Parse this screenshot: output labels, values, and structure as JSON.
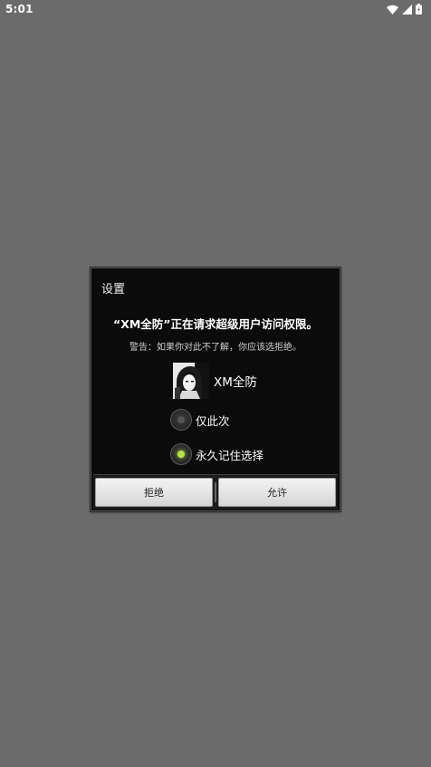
{
  "status_bar": {
    "time": "5:01",
    "icons": [
      "wifi-icon",
      "signal-icon",
      "battery-icon"
    ]
  },
  "dialog": {
    "title": "设置",
    "headline": "“XM全防”正在请求超级用户访问权限。",
    "warning": "警告：如果你对此不了解，你应该选拒绝。",
    "app_name": "XM全防",
    "options": [
      {
        "label": "仅此次",
        "selected": false
      },
      {
        "label": "永久记住选择",
        "selected": true
      }
    ],
    "buttons": {
      "deny": "拒绝",
      "allow": "允许"
    }
  },
  "colors": {
    "background": "#6b6b6b",
    "dialog": "#0a0a0a",
    "radio_selected": "#b7e34a"
  }
}
